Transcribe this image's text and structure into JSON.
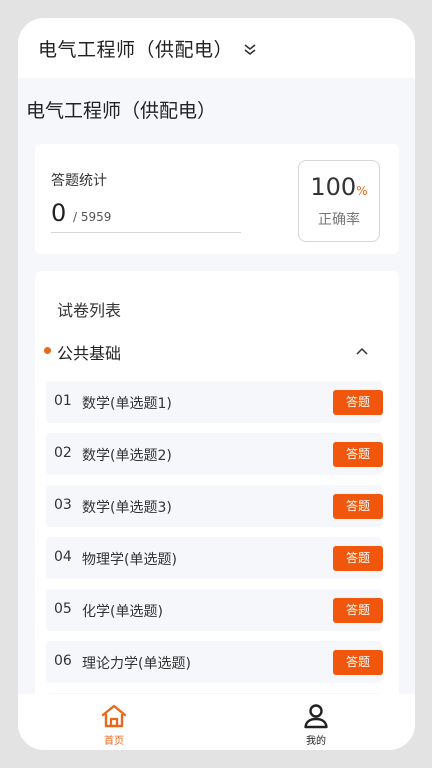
{
  "header": {
    "title": "电气工程师（供配电）",
    "dropdown_icon": "double-chevron-down-icon"
  },
  "page": {
    "title": "电气工程师（供配电）"
  },
  "stats": {
    "label": "答题统计",
    "answered": "0",
    "total": "/ 5959",
    "rate_value": "100",
    "rate_unit": "%",
    "rate_label": "正确率"
  },
  "paper_list": {
    "heading": "试卷列表",
    "category": {
      "label": "公共基础",
      "toggle_icon": "chevron-up-icon"
    },
    "items": [
      {
        "no": "01",
        "name": "数学(单选题1)",
        "button": "答题"
      },
      {
        "no": "02",
        "name": "数学(单选题2)",
        "button": "答题"
      },
      {
        "no": "03",
        "name": "数学(单选题3)",
        "button": "答题"
      },
      {
        "no": "04",
        "name": "物理学(单选题)",
        "button": "答题"
      },
      {
        "no": "05",
        "name": "化学(单选题)",
        "button": "答题"
      },
      {
        "no": "06",
        "name": "理论力学(单选题)",
        "button": "答题"
      }
    ]
  },
  "bottom_nav": {
    "items": [
      {
        "label": "首页",
        "icon": "home-icon",
        "active": true
      },
      {
        "label": "我的",
        "icon": "user-icon",
        "active": false
      }
    ]
  },
  "colors": {
    "accent": "#f0570c",
    "accent_text": "#e8681e"
  }
}
